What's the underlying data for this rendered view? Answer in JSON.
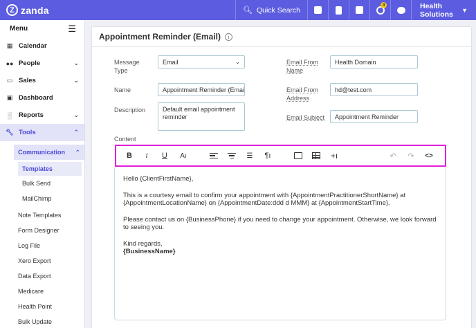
{
  "brand": {
    "name": "zanda",
    "mark": "Z"
  },
  "topbar": {
    "quick_search": "Quick Search",
    "notifications_count": "4",
    "account": "Health Solutions",
    "icons": [
      "search-icon",
      "report-icon",
      "clipboard-icon",
      "calendar-icon",
      "tasks-icon",
      "chat-icon"
    ]
  },
  "sidebar": {
    "menu_label": "Menu",
    "items": [
      {
        "label": "Calendar",
        "icon": "calendar-icon"
      },
      {
        "label": "People",
        "icon": "people-icon"
      },
      {
        "label": "Sales",
        "icon": "sales-icon"
      },
      {
        "label": "Dashboard",
        "icon": "dashboard-icon"
      },
      {
        "label": "Reports",
        "icon": "reports-icon"
      },
      {
        "label": "Tools",
        "icon": "wrench-icon"
      }
    ],
    "communication": "Communication",
    "comm_items": [
      "Templates",
      "Bulk Send",
      "MailChimp"
    ],
    "tool_items": [
      "Note Templates",
      "Form Designer",
      "Log File",
      "Xero Export",
      "Data Export",
      "Medicare",
      "Health Point",
      "Bulk Update"
    ]
  },
  "form": {
    "title": "Appointment Reminder (Email)",
    "message_type_label": "Message Type",
    "message_type_value": "Email",
    "name_label": "Name",
    "name_value": "Appointment Reminder (Email",
    "description_label": "Description",
    "description_value": "Default email appointment reminder",
    "email_from_name_label": "Email From Name",
    "email_from_name_value": "Health Domain",
    "email_from_address_label": "Email From Address",
    "email_from_address_value": "hd@test.com",
    "email_subject_label": "Email Subject",
    "email_subject_value": "Appointment Reminder",
    "content_label": "Content"
  },
  "toolbar": {
    "bold": "B",
    "italic": "i",
    "underline": "U",
    "font_size": "Aı",
    "paragraph": "¶ı",
    "insert": "+ı",
    "undo": "↶",
    "redo": "↷",
    "code": "<>"
  },
  "content": {
    "greeting": "Hello {ClientFirstName},",
    "p1": "This is a courtesy email to confirm your appointment with {AppointmentPractitionerShortName} at {AppointmentLocationName} on {AppointmentDate:ddd d MMM} at {AppointmentStartTime}.",
    "p2": "Please contact us on {BusinessPhone} if you need to change your appointment. Otherwise, we look forward to seeing you.",
    "signoff": "Kind regards,",
    "signature": "{BusinessName}"
  }
}
